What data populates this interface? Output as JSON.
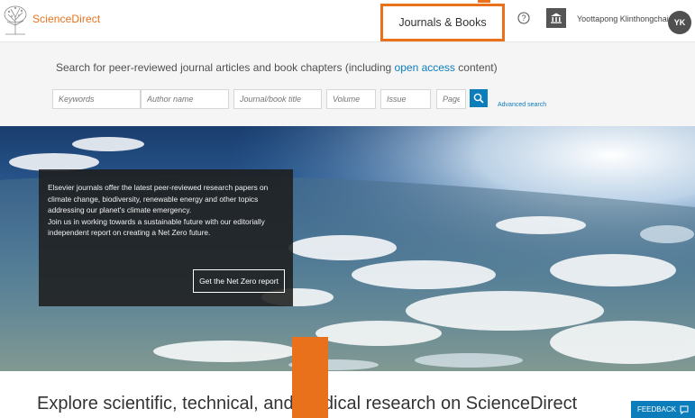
{
  "header": {
    "brand": "ScienceDirect",
    "journals_books": "Journals & Books",
    "user_name": "Yoottapong Klinthongchai",
    "avatar_initials": "YK",
    "accent_color": "#e9711c"
  },
  "search": {
    "heading_pre": "Search for peer-reviewed journal articles and book chapters (including ",
    "heading_link": "open access",
    "heading_post": " content)",
    "fields": {
      "keywords": "Keywords",
      "author": "Author name",
      "journal": "Journal/book title",
      "volume": "Volume",
      "issue": "Issue",
      "pages": "Pages"
    },
    "advanced": "Advanced search",
    "link_color": "#0c7dbb"
  },
  "hero": {
    "lines": [
      "Elsevier journals offer the latest peer-reviewed research papers on",
      "climate change, biodiversity, renewable energy and other topics",
      "addressing our planet's climate emergency.",
      "Join us in working towards a sustainable future with our editorially",
      "independent report on creating a Net Zero future."
    ],
    "button": "Get the Net Zero report"
  },
  "explore": {
    "text": "Explore scientific, technical, and medical research on ScienceDirect"
  },
  "feedback": {
    "label": "FEEDBACK"
  }
}
